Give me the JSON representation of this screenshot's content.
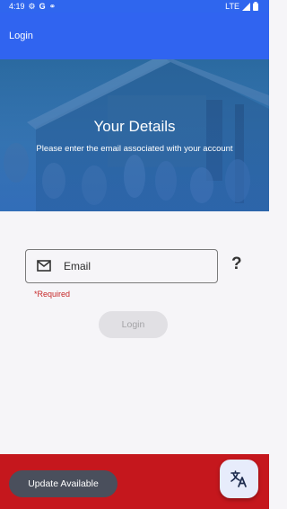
{
  "status_bar": {
    "time": "4:19",
    "left_icons": [
      "settings-icon",
      "google-icon",
      "sync-icon"
    ],
    "network": "LTE",
    "right_icons": [
      "signal-icon",
      "battery-icon"
    ]
  },
  "app_bar": {
    "title": "Login"
  },
  "hero": {
    "title": "Your Details",
    "subtitle": "Please enter the email associated with your account"
  },
  "form": {
    "email_placeholder": "Email",
    "email_value": "",
    "email_icon": "mail-icon",
    "help_label": "?",
    "required_text": "*Required",
    "login_label": "Login"
  },
  "footer": {
    "update_label": "Update Available",
    "translate_icon": "translate-icon"
  },
  "colors": {
    "primary": "#3064f0",
    "footer": "#c5171d",
    "error": "#c62828",
    "update_button": "#4a4f5c"
  }
}
